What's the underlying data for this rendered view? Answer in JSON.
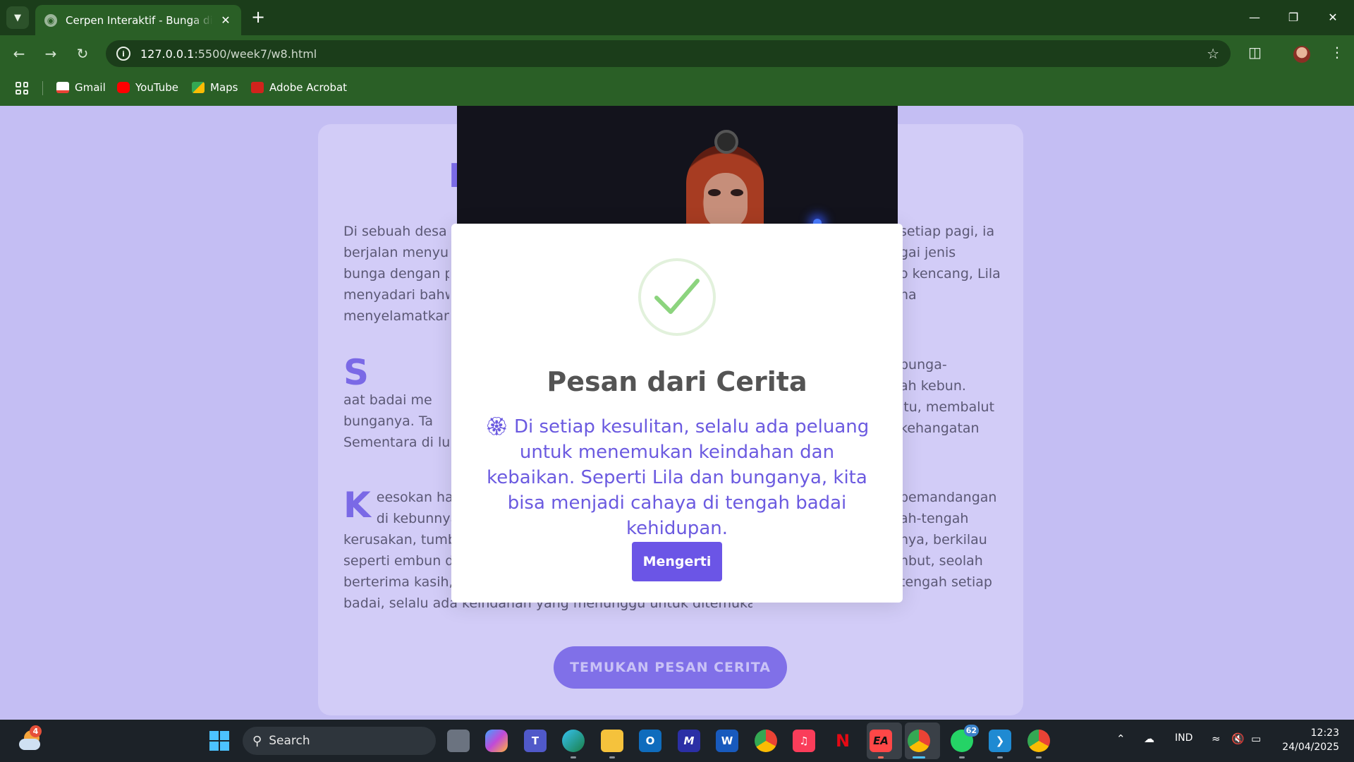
{
  "browser": {
    "tab_title": "Cerpen Interaktif - Bunga di Tengah Badai",
    "url_host": "127.0.0.1",
    "url_path": ":5500/week7/w8.html",
    "bookmarks": [
      {
        "label": "Gmail",
        "color": "#ea4335"
      },
      {
        "label": "YouTube",
        "color": "#ff0000"
      },
      {
        "label": "Maps",
        "color": "#34a853"
      },
      {
        "label": "Adobe Acrobat",
        "color": "#d1231c"
      }
    ]
  },
  "page": {
    "title_fragment": "B",
    "paragraph1_left": "Di sebuah desa k\nberjalan menyusu\nbunga dengan pe\nmenyadari bahwa\nmenyelamatkan b",
    "paragraph1_right": "setiap pagi, ia\ngai jenis\no kencang, Lila\nna",
    "paragraph2_dropcap": "S",
    "paragraph2_left": "aat badai me\nbunganya. Ta\nSementara di luar\nsayapnya yang pa\nyang tercipta anta",
    "paragraph2_right": "bunga-\nah kebun.\nitu, membalut\nkehangatan",
    "paragraph3_dropcap": "K",
    "paragraph3_left": "eesokan hari\ndi kebunnya\nkerusakan, tumbu\nseperti embun di\nberterima kasih, s\nbadai, selalu ada keindahan yang menunggu untuk ditemukan.",
    "paragraph3_right": "pemandangan\nah-tengah\nnya, berkilau\nnbut, seolah\ntengah setiap",
    "cta_label": "TEMUKAN PESAN CERITA"
  },
  "modal": {
    "title": "Pesan dari Cerita",
    "message": "🏵 Di setiap kesulitan, selalu ada peluang untuk menemukan keindahan dan kebaikan. Seperti Lila dan bunganya, kita bisa menjadi cahaya di tengah badai kehidupan.",
    "button_label": "Mengerti",
    "success_color": "#8cd47e",
    "accent_color": "#6b55e6"
  },
  "taskbar": {
    "search_placeholder": "Search",
    "weather_badge": "4",
    "whatsapp_badge": "62",
    "language": "IND",
    "time": "12:23",
    "date": "24/04/2025"
  }
}
